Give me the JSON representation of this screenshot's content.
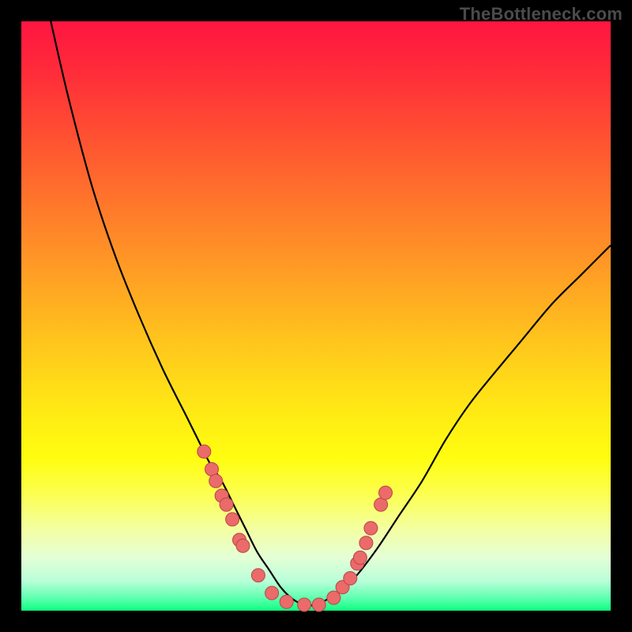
{
  "attribution": "TheBottleneck.com",
  "colors": {
    "frame": "#000000",
    "gradient_top": "#ff1541",
    "gradient_bottom": "#0dff7f",
    "curve_stroke": "#000000",
    "dot_fill": "#eb6a6a",
    "dot_stroke": "#b74848"
  },
  "chart_data": {
    "type": "line",
    "title": "",
    "xlabel": "",
    "ylabel": "",
    "xlim": [
      0,
      100
    ],
    "ylim": [
      0,
      100
    ],
    "series": [
      {
        "name": "bottleneck-curve",
        "x": [
          5,
          8,
          12,
          16,
          20,
          24,
          28,
          30,
          32,
          34,
          36,
          38,
          40,
          42,
          44,
          46,
          48,
          50,
          52,
          56,
          60,
          64,
          68,
          72,
          76,
          80,
          85,
          90,
          95,
          100
        ],
        "y": [
          100,
          87,
          72,
          60,
          50,
          41,
          33,
          29,
          25,
          22,
          18,
          14,
          10,
          7,
          4,
          2,
          1,
          1,
          2,
          5,
          10,
          16,
          22,
          29,
          35,
          40,
          46,
          52,
          57,
          62
        ]
      }
    ],
    "dots": {
      "name": "sample-points",
      "x": [
        31.0,
        32.3,
        33.0,
        34.0,
        34.8,
        35.8,
        37.0,
        37.6,
        40.2,
        42.5,
        45.0,
        48.0,
        50.5,
        53.0,
        54.5,
        55.8,
        57.0,
        57.5,
        58.5,
        59.3,
        61.0,
        61.8
      ],
      "y": [
        27.0,
        24.0,
        22.0,
        19.5,
        18.0,
        15.5,
        12.0,
        11.0,
        6.0,
        3.0,
        1.5,
        1.0,
        1.0,
        2.2,
        4.0,
        5.5,
        8.0,
        9.0,
        11.5,
        14.0,
        18.0,
        20.0
      ]
    }
  }
}
